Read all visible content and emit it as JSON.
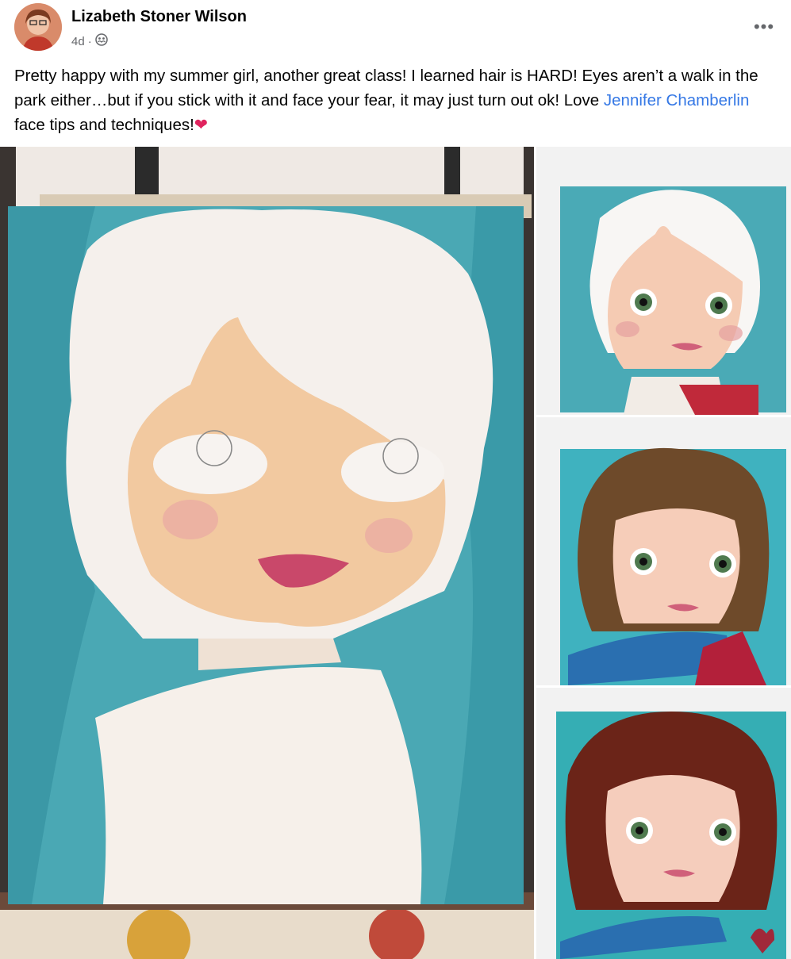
{
  "post": {
    "author": "Lizabeth Stoner Wilson",
    "time": "4d",
    "separator": "·",
    "audience_icon": "friends-globe-icon",
    "more_icon": "more-options-icon",
    "text_before": "Pretty happy with my summer girl, another great class! I learned hair is HARD! Eyes aren’t a walk in the park either…but if you stick with it and face your fear, it may just turn out ok! Love ",
    "mention": "Jennifer Chamberlin",
    "text_after": " face tips and techniques!",
    "emoji": "❤"
  },
  "photos": [
    {
      "name": "main-painting-photo",
      "subject": "unfinished watercolor girl portrait"
    },
    {
      "name": "thumbnail-white-hair",
      "subject": "painting girl white hair"
    },
    {
      "name": "thumbnail-brown-hair",
      "subject": "painting girl brown hair blue scarf"
    },
    {
      "name": "thumbnail-auburn-hair",
      "subject": "painting girl auburn hair blue scarf"
    }
  ],
  "colors": {
    "link": "#3578e5",
    "meta": "#65676b",
    "teal": "#4aa8b4",
    "skin": "#f2c9a0"
  }
}
